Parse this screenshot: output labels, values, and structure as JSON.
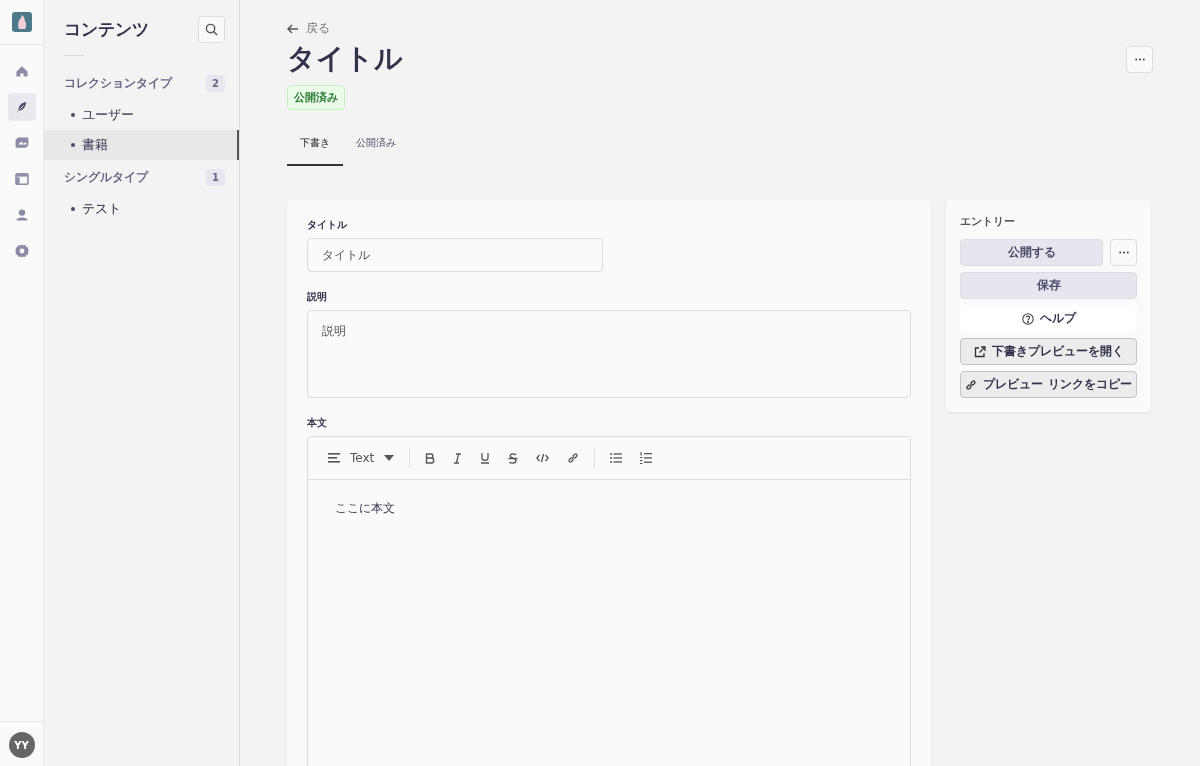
{
  "nav": {
    "items": [
      {
        "kind": "home",
        "selected": false
      },
      {
        "kind": "content",
        "selected": true
      },
      {
        "kind": "media",
        "selected": false
      },
      {
        "kind": "layout",
        "selected": false
      },
      {
        "kind": "user",
        "selected": false
      },
      {
        "kind": "settings",
        "selected": false
      }
    ],
    "avatar": "YY"
  },
  "sidebar": {
    "title": "コンテンツ",
    "sections": [
      {
        "label": "コレクションタイプ",
        "count": "2",
        "items": [
          {
            "label": "ユーザー",
            "selected": false
          },
          {
            "label": "書籍",
            "selected": true
          }
        ]
      },
      {
        "label": "シングルタイプ",
        "count": "1",
        "items": [
          {
            "label": "テスト",
            "selected": false
          }
        ]
      }
    ]
  },
  "header": {
    "back": "戻る",
    "title": "タイトル",
    "status": "公開済み"
  },
  "tabs": [
    {
      "label": "下書き",
      "selected": true
    },
    {
      "label": "公開済み",
      "selected": false
    }
  ],
  "form": {
    "fields": [
      {
        "kind": "text",
        "label": "タイトル",
        "placeholder": "タイトル"
      },
      {
        "kind": "textarea",
        "label": "説明",
        "placeholder": "説明"
      },
      {
        "kind": "richtext",
        "label": "本文",
        "block_type": "Text",
        "value": "ここに本文"
      }
    ]
  },
  "entry": {
    "title": "エントリー",
    "buttons": [
      {
        "kind": "primary",
        "label": "公開する"
      },
      {
        "kind": "primary",
        "label": "保存"
      },
      {
        "kind": "help",
        "label": "ヘルプ"
      },
      {
        "kind": "external",
        "label": "下書きプレビューを開く"
      },
      {
        "kind": "link",
        "label": "プレビュー リンクをコピー"
      }
    ]
  }
}
